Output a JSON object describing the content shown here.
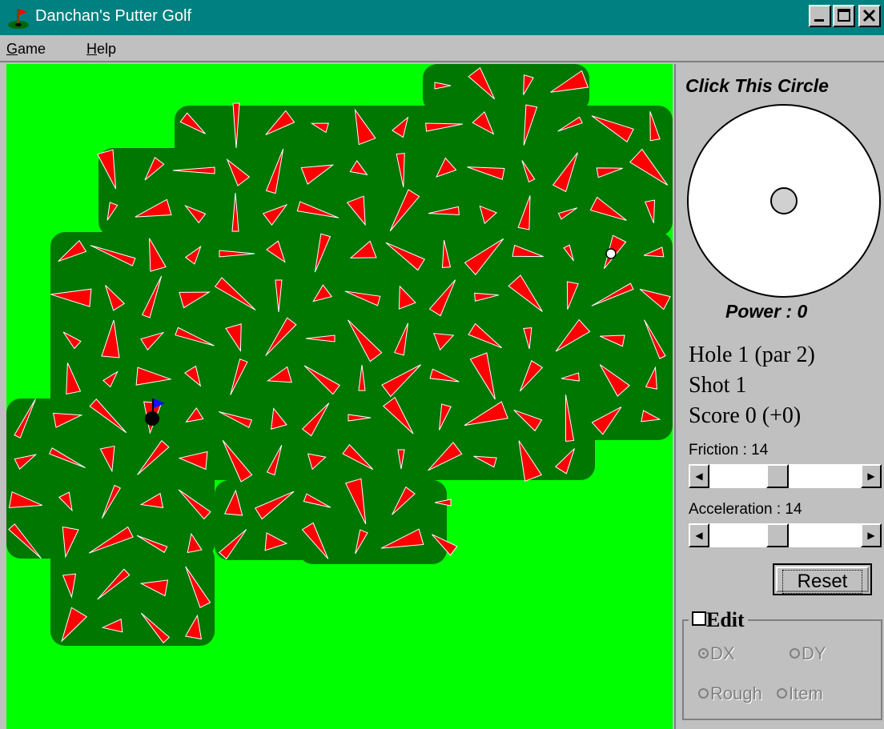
{
  "window": {
    "title": "Danchan's Putter Golf"
  },
  "menu": {
    "items": [
      "Game",
      "Help"
    ]
  },
  "panel": {
    "click_label": "Click This Circle",
    "power_label": "Power : 0",
    "hole_line": "Hole 1 (par 2)",
    "shot_line": "Shot 1",
    "score_line": "Score 0 (+0)",
    "friction_label": "Friction : 14",
    "friction_value": 14,
    "acceleration_label": "Acceleration : 14",
    "acceleration_value": 14,
    "reset_label": "Reset",
    "edit_label": "Edit",
    "edit_checked": false,
    "radio_dx": "DX",
    "radio_dy": "DY",
    "radio_rough": "Rough",
    "radio_item": "Item",
    "selected_radio": "DX"
  },
  "colors": {
    "rough": "#00ff00",
    "fairway": "#007700",
    "arrow": "#ff0000",
    "titlebar": "#008080",
    "flag": "#1010ff",
    "ball": "#ffffff",
    "hole": "#000000"
  },
  "icons": {
    "app": "golf-flag-icon",
    "minimize": "minimize-icon",
    "maximize": "maximize-icon",
    "close": "close-icon",
    "scroll_left": "arrow-left-icon",
    "scroll_right": "arrow-right-icon"
  }
}
